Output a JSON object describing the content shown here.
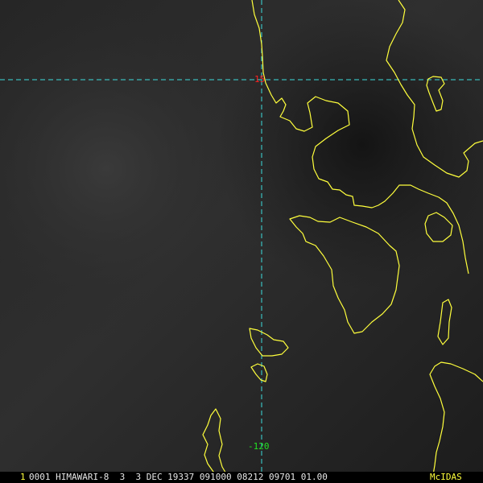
{
  "colors": {
    "coastline": "#ffff3c",
    "gridline": "#3cdcdc",
    "lat_label": "#ff2020",
    "lon_label": "#22e022",
    "status_text": "#e8e8e8",
    "frame_number": "#ffff3c",
    "brand": "#ffff3c"
  },
  "grid": {
    "latitude_label": "15",
    "longitude_label": "-120"
  },
  "status_bar": {
    "frame_number": "1",
    "info": "0001 HIMAWARI-8  3  3 DEC 19337 091000 08212 09701 01.00",
    "brand": "McIDAS"
  }
}
